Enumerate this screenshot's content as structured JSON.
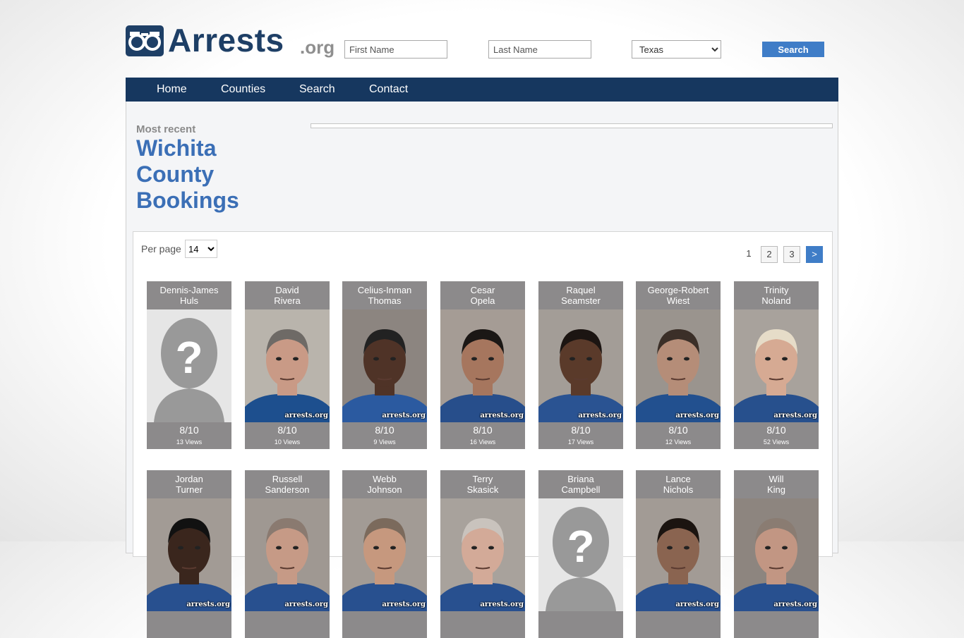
{
  "header": {
    "logo_text": "Arrests",
    "logo_suffix": ".org",
    "first_name_placeholder": "First Name",
    "last_name_placeholder": "Last Name",
    "state_selected": "Texas",
    "search_label": "Search"
  },
  "nav": {
    "items": [
      "Home",
      "Counties",
      "Search",
      "Contact"
    ]
  },
  "page": {
    "most_recent": "Most recent",
    "title_lines": [
      "Wichita",
      "County",
      "Bookings"
    ]
  },
  "listing": {
    "per_page_label": "Per page",
    "per_page_value": "14",
    "pagination": [
      "1",
      "2",
      "3",
      ">"
    ],
    "watermark": "arrests.org",
    "people": [
      {
        "first": "Dennis-James",
        "last": "Huls",
        "rating": "8/10",
        "views": "13 Views",
        "photo": "placeholder"
      },
      {
        "first": "David",
        "last": "Rivera",
        "rating": "8/10",
        "views": "10 Views",
        "photo": "mugshot",
        "bg": "#b9b4ac",
        "skin": "#c99a86",
        "hair": "#6e6a66",
        "shirt": "#1d4f8e"
      },
      {
        "first": "Celius-Inman",
        "last": "Thomas",
        "rating": "8/10",
        "views": "9 Views",
        "photo": "mugshot",
        "bg": "#8c8580",
        "skin": "#4f3327",
        "hair": "#222",
        "shirt": "#2b5aa0"
      },
      {
        "first": "Cesar",
        "last": "Opela",
        "rating": "8/10",
        "views": "16 Views",
        "photo": "mugshot",
        "bg": "#a59c95",
        "skin": "#a6765e",
        "hair": "#1b1715",
        "shirt": "#274e8b"
      },
      {
        "first": "Raquel",
        "last": "Seamster",
        "rating": "8/10",
        "views": "17 Views",
        "photo": "mugshot",
        "bg": "#a39d97",
        "skin": "#5a3a2a",
        "hair": "#1c1512",
        "shirt": "#2a5392"
      },
      {
        "first": "George-Robert",
        "last": "Wiest",
        "rating": "8/10",
        "views": "12 Views",
        "photo": "mugshot",
        "bg": "#9a948e",
        "skin": "#b58d78",
        "hair": "#3b2f28",
        "shirt": "#22508f"
      },
      {
        "first": "Trinity",
        "last": "Noland",
        "rating": "8/10",
        "views": "52 Views",
        "photo": "mugshot",
        "bg": "#a8a29c",
        "skin": "#d6aa93",
        "hair": "#e6dcc8",
        "shirt": "#27508d"
      },
      {
        "first": "Jordan",
        "last": "Turner",
        "photo": "mugshot",
        "bg": "#a29b95",
        "skin": "#3a261d",
        "hair": "#111",
        "shirt": "#28508f"
      },
      {
        "first": "Russell",
        "last": "Sanderson",
        "photo": "mugshot",
        "bg": "#9f9892",
        "skin": "#c69a86",
        "hair": "#8a7a70",
        "shirt": "#28508f"
      },
      {
        "first": "Webb",
        "last": "Johnson",
        "photo": "mugshot",
        "bg": "#a29b95",
        "skin": "#c6987e",
        "hair": "#7b6a5c",
        "shirt": "#28508f"
      },
      {
        "first": "Terry",
        "last": "Skasick",
        "photo": "mugshot",
        "bg": "#a8a29c",
        "skin": "#d3aa98",
        "hair": "#c9c3bd",
        "shirt": "#28508f"
      },
      {
        "first": "Briana",
        "last": "Campbell",
        "photo": "placeholder"
      },
      {
        "first": "Lance",
        "last": "Nichols",
        "photo": "mugshot",
        "bg": "#a29b95",
        "skin": "#8a6450",
        "hair": "#1b1410",
        "shirt": "#28508f"
      },
      {
        "first": "Will",
        "last": "King",
        "photo": "mugshot",
        "bg": "#8d857f",
        "skin": "#c29683",
        "hair": "#8a7c72",
        "shirt": "#28508f"
      }
    ]
  }
}
